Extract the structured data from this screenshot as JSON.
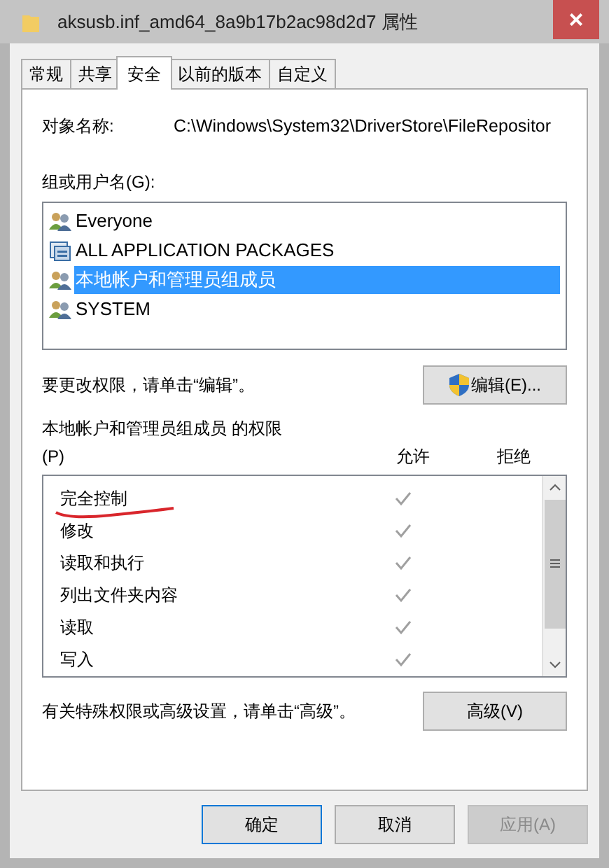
{
  "window": {
    "title": "aksusb.inf_amd64_8a9b17b2ac98d2d7 属性",
    "close": "×"
  },
  "tabs": [
    {
      "label": "常规",
      "selected": false
    },
    {
      "label": "共享",
      "selected": false
    },
    {
      "label": "安全",
      "selected": true
    },
    {
      "label": "以前的版本",
      "selected": false
    },
    {
      "label": "自定义",
      "selected": false
    }
  ],
  "object_name": {
    "label": "对象名称:",
    "value": "C:\\Windows\\System32\\DriverStore\\FileRepositor"
  },
  "groups": {
    "label": "组或用户名(G):",
    "items": [
      {
        "name": "Everyone",
        "kind": "users",
        "selected": false
      },
      {
        "name": "ALL APPLICATION PACKAGES",
        "kind": "packages",
        "selected": false
      },
      {
        "name": "本地帐户和管理员组成员",
        "kind": "users",
        "selected": true
      },
      {
        "name": "SYSTEM",
        "kind": "users",
        "selected": false
      }
    ]
  },
  "edit_hint": "要更改权限，请单击“编辑”。",
  "edit_button": "编辑(E)...",
  "permissions": {
    "title": "本地帐户和管理员组成员 的权限",
    "shortcut": "(P)",
    "allow_header": "允许",
    "deny_header": "拒绝",
    "items": [
      {
        "name": "完全控制",
        "allow": true,
        "deny": false,
        "underlined": true
      },
      {
        "name": "修改",
        "allow": true,
        "deny": false,
        "underlined": false
      },
      {
        "name": "读取和执行",
        "allow": true,
        "deny": false,
        "underlined": false
      },
      {
        "name": "列出文件夹内容",
        "allow": true,
        "deny": false,
        "underlined": false
      },
      {
        "name": "读取",
        "allow": true,
        "deny": false,
        "underlined": false
      },
      {
        "name": "写入",
        "allow": true,
        "deny": false,
        "underlined": false
      }
    ]
  },
  "advanced_hint": "有关特殊权限或高级设置，请单击“高级”。",
  "advanced_button": "高级(V)",
  "buttons": [
    {
      "label": "确定",
      "disabled": false
    },
    {
      "label": "取消",
      "disabled": false
    },
    {
      "label": "应用(A)",
      "disabled": true
    }
  ]
}
